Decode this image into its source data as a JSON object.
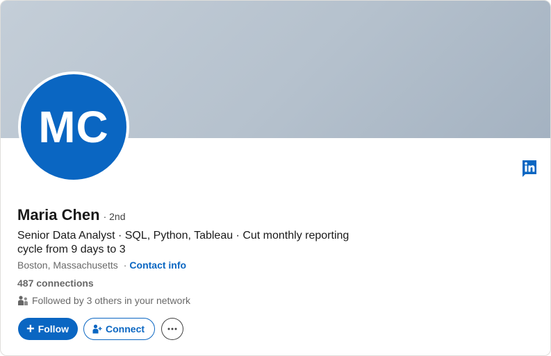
{
  "profile": {
    "initials": "MC",
    "name": "Maria Chen",
    "degree": "· 2nd",
    "headline": "Senior Data Analyst · SQL, Python, Tableau · Cut monthly reporting cycle from 9 days to 3",
    "location": "Boston, Massachusetts",
    "separator": "·",
    "contact_label": "Contact info",
    "connections": "487 connections",
    "followed_by": "Followed by 3 others in your network"
  },
  "actions": {
    "follow_label": "Follow",
    "connect_label": "Connect"
  },
  "icons": {
    "logo": "linkedin-logo-icon",
    "mutual": "people-icon",
    "connect": "person-add-icon",
    "more": "ellipsis-icon"
  },
  "colors": {
    "brand": "#0a66c2",
    "banner": "#b5c1cd"
  }
}
